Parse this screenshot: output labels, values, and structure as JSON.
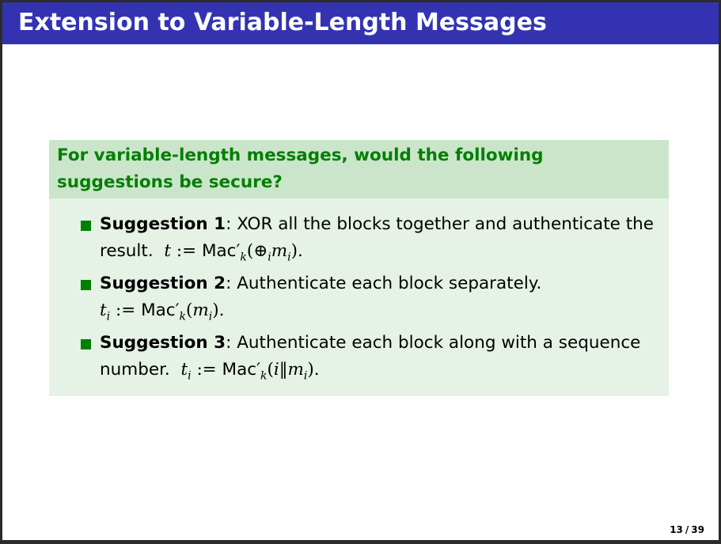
{
  "slide": {
    "title": "Extension to Variable-Length Messages"
  },
  "block": {
    "heading": "For variable-length messages, would the following suggestions be secure?",
    "items": [
      {
        "name": "Suggestion 1",
        "text": ": XOR all the blocks together and authenticate the result."
      },
      {
        "name": "Suggestion 2",
        "text": ": Authenticate each block separately."
      },
      {
        "name": "Suggestion 3",
        "text": ": Authenticate each block along with a sequence number."
      }
    ]
  },
  "footer": {
    "current_page": "13",
    "separator": "/",
    "total_pages": "39"
  },
  "colors": {
    "title_bar": "#3333b2",
    "block_header": "#cbe5cb",
    "block_body": "#e5f2e5",
    "heading_text": "#007f00",
    "bullet": "#007f00"
  }
}
